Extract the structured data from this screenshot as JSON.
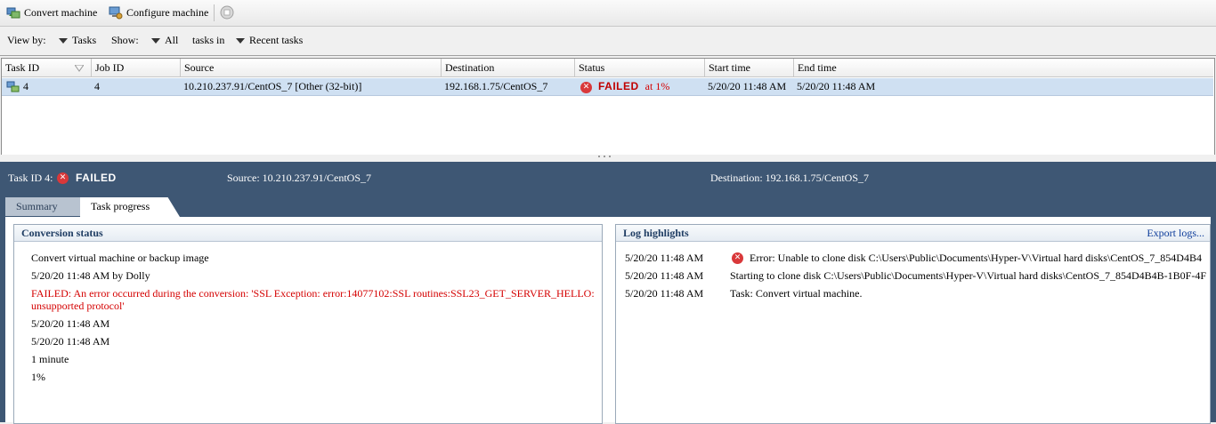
{
  "toolbar": {
    "convert_label": "Convert machine",
    "configure_label": "Configure machine"
  },
  "filter": {
    "view_by_label": "View by:",
    "view_by_value": "Tasks",
    "show_label": "Show:",
    "show_value": "All",
    "tasks_in_label": "tasks in",
    "tasks_in_value": "Recent tasks"
  },
  "grid": {
    "columns": [
      "Task ID",
      "Job ID",
      "Source",
      "Destination",
      "Status",
      "Start time",
      "End time"
    ],
    "rows": [
      {
        "task_id": "4",
        "job_id": "4",
        "source": "10.210.237.91/CentOS_7 [Other (32-bit)]",
        "destination": "192.168.1.75/CentOS_7",
        "status": "FAILED",
        "progress": "at 1%",
        "start_time": "5/20/20 11:48 AM",
        "end_time": "5/20/20 11:48 AM"
      }
    ]
  },
  "detail": {
    "task_label": "Task ID 4:",
    "status": "FAILED",
    "source_label": "Source:",
    "source_value": "10.210.237.91/CentOS_7",
    "destination_label": "Destination:",
    "destination_value": "192.168.1.75/CentOS_7",
    "tabs": [
      "Summary",
      "Task progress"
    ],
    "active_tab": "Task progress"
  },
  "conversion": {
    "title": "Conversion status",
    "task_name": "Convert virtual machine or backup image",
    "created": "5/20/20 11:48 AM by Dolly",
    "error_line1": "FAILED: An error occurred during the conversion: 'SSL Exception: error:14077102:SSL routines:SSL23_GET_SERVER_HELLO:",
    "error_line2": "unsupported protocol'",
    "start": "5/20/20 11:48 AM",
    "end": "5/20/20 11:48 AM",
    "duration": "1 minute",
    "progress": "1%"
  },
  "log": {
    "title": "Log highlights",
    "export_label": "Export logs...",
    "entries": [
      {
        "time": "5/20/20 11:48 AM",
        "message": "Error: Unable to clone disk C:\\Users\\Public\\Documents\\Hyper-V\\Virtual hard disks\\CentOS_7_854D4B4"
      },
      {
        "time": "5/20/20 11:48 AM",
        "message": "Starting to clone disk C:\\Users\\Public\\Documents\\Hyper-V\\Virtual hard disks\\CentOS_7_854D4B4B-1B0F-4F"
      },
      {
        "time": "5/20/20 11:48 AM",
        "message": "Task: Convert virtual machine."
      }
    ]
  },
  "colors": {
    "panel_bg": "#3e5774",
    "selected_row": "#cfe0f2",
    "error_red": "#d40000"
  },
  "icons": [
    "convert-machine-icon",
    "configure-machine-icon",
    "stop-icon",
    "task-icon",
    "error-icon"
  ]
}
